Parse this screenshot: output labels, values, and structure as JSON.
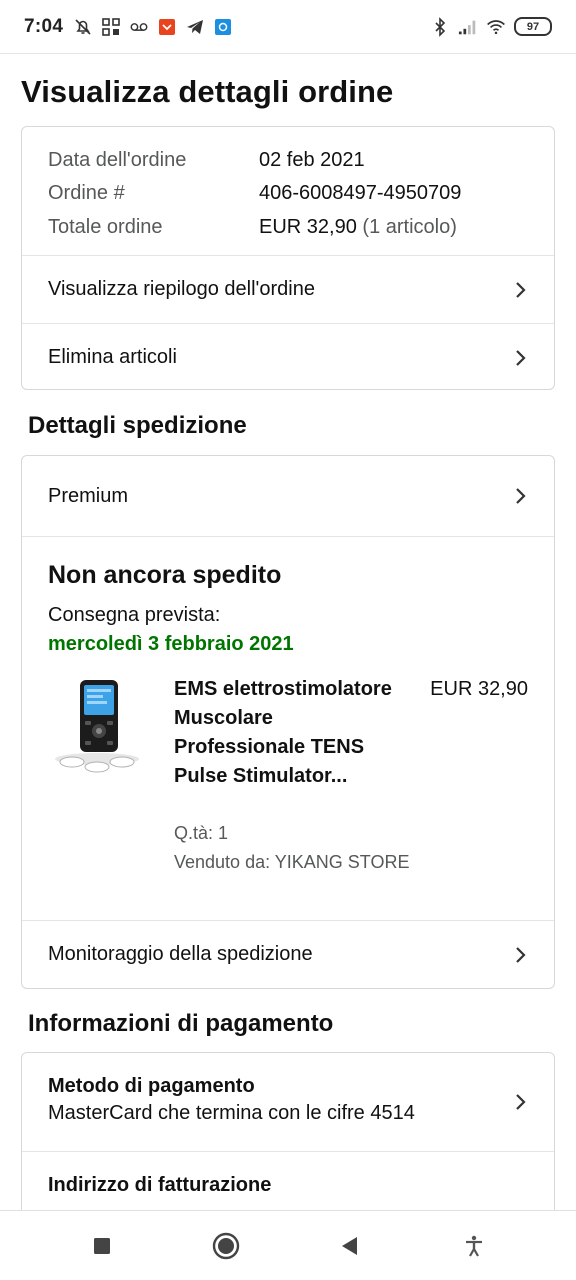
{
  "status_bar": {
    "time": "7:04",
    "battery": "97",
    "left_icons": [
      "alarm-off-icon",
      "apps-icon",
      "voicemail-icon",
      "notification-app-icon",
      "telegram-icon",
      "app-badge-icon"
    ],
    "right_icons": [
      "bluetooth-icon",
      "signal-icon",
      "wifi-icon"
    ]
  },
  "page": {
    "title": "Visualizza dettagli ordine"
  },
  "order_summary": {
    "date_label": "Data dell'ordine",
    "date_value": "02 feb 2021",
    "order_label": "Ordine #",
    "order_value": "406-6008497-4950709",
    "total_label": "Totale ordine",
    "total_value": "EUR 32,90",
    "total_items": "(1 articolo)",
    "view_summary_label": "Visualizza riepilogo dell'ordine",
    "delete_items_label": "Elimina articoli"
  },
  "shipping": {
    "section_title": "Dettagli spedizione",
    "premium_label": "Premium",
    "status": "Non ancora spedito",
    "delivery_label": "Consegna prevista:",
    "delivery_date": "mercoledì 3 febbraio 2021",
    "product": {
      "title": "EMS elettrostimolatore Muscolare Professionale TENS Pulse Stimulator...",
      "price": "EUR 32,90",
      "quantity": "Q.tà: 1",
      "seller": "Venduto da: YIKANG STORE"
    },
    "tracking_label": "Monitoraggio della spedizione"
  },
  "payment": {
    "section_title": "Informazioni di pagamento",
    "method_title": "Metodo di pagamento",
    "method_value": "MasterCard che termina con le cifre 4514",
    "billing_title": "Indirizzo di fatturazione"
  },
  "colors": {
    "delivery_green": "#007600",
    "border": "#d5d9d9",
    "muted_text": "#565959"
  },
  "nav_bar": {
    "icons": [
      "recents-square-icon",
      "home-circle-icon",
      "back-triangle-icon",
      "accessibility-icon"
    ]
  }
}
